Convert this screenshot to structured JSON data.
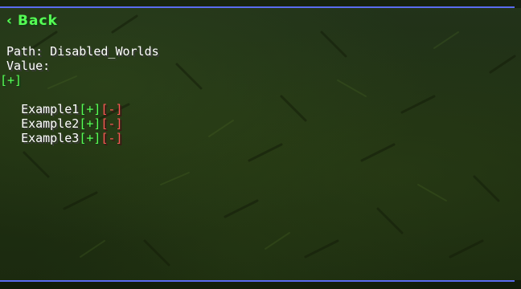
{
  "header": {
    "back_label": "Back",
    "back_icon": "chevron-left-icon"
  },
  "config": {
    "path_label": "Path: Disabled_Worlds",
    "value_label": "Value:",
    "add_root": "[+]",
    "entries": [
      {
        "name": "Example1",
        "add": "[+]",
        "remove": "[-]"
      },
      {
        "name": "Example2",
        "add": "[+]",
        "remove": "[-]"
      },
      {
        "name": "Example3",
        "add": "[+]",
        "remove": "[-]"
      }
    ]
  },
  "colors": {
    "accent_green": "#55ff55",
    "accent_red": "#ff5555",
    "rule_blue": "#5a6cf0",
    "text": "#ffffff"
  }
}
